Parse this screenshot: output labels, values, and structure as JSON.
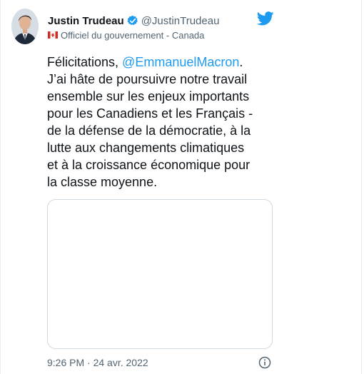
{
  "author": {
    "display_name": "Justin Trudeau",
    "handle": "@JustinTrudeau",
    "affiliation": "Officiel du gouvernement - Canada",
    "avatar_icon": "profile-photo",
    "verified_icon": "verified-badge-icon",
    "flag_icon": "canada-flag-icon"
  },
  "tweet": {
    "line1_text": "Félicitations, ",
    "mention": "@EmmanuelMacron",
    "line1_end": ".",
    "line2": "J’ai hâte de poursuivre notre travail",
    "line3": "ensemble sur les enjeux importants",
    "line4": "pour les Canadiens et les Français -",
    "line5": "de la défense de la démocratie, à la",
    "line6": "lutte aux changements climatiques",
    "line7": "et à la croissance économique pour",
    "line8": "la classe moyenne."
  },
  "meta": {
    "timestamp": "9:26 PM · 24 avr. 2022"
  },
  "colors": {
    "accent": "#1d9bf0",
    "text": "#0f1419",
    "secondary_text": "#536471",
    "border": "#cfd9de"
  }
}
